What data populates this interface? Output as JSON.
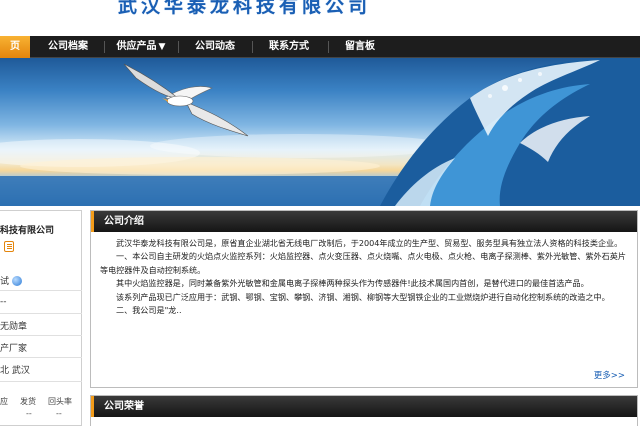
{
  "header": {
    "company_name": "武汉华泰龙科技有限公司"
  },
  "nav": {
    "items": [
      {
        "label": "页"
      },
      {
        "label": "公司档案"
      },
      {
        "label": "供应产品"
      },
      {
        "label": "公司动态"
      },
      {
        "label": "联系方式"
      },
      {
        "label": "留言板"
      }
    ],
    "dropdown_arrow": "▼"
  },
  "sidebar": {
    "company_name": "科技有限公司",
    "rows": [
      {
        "label": "试"
      },
      {
        "label": "--"
      },
      {
        "label": "无勋章"
      },
      {
        "label": "产厂家"
      },
      {
        "label": "北 武汉"
      }
    ],
    "stats": {
      "headers": [
        "应",
        "发货",
        "回头率"
      ],
      "values": [
        "",
        "--",
        "--"
      ]
    }
  },
  "intro": {
    "title": "公司介绍",
    "paragraphs": [
      "武汉华泰龙科技有限公司是，原省直企业湖北省无线电厂改制后，于2004年成立的生产型、贸易型、服务型具有独立法人资格的科技类企业。",
      "一、本公司自主研发的火焰点火监控系列：火焰监控器、点火变压器、点火烧嘴、点火电极、点火枪、电离子探测棒、紫外光敏管、紫外石英片等电控器件及自动控制系统。",
      "其中火焰监控器是，同时兼备紫外光敏管和金属电离子探棒两种探头作为传感器件!此技术属国内首创，是替代进口的最佳首选产品。",
      "该系列产品现已广泛应用于：武钢、鄂钢、宝钢、攀钢、济钢、湘钢、柳钢等大型钢铁企业的工业燃烧炉进行自动化控制系统的改造之中。",
      "二、我公司是\"龙.."
    ],
    "more_label": "更多>>"
  },
  "honor": {
    "title": "公司荣誉"
  }
}
